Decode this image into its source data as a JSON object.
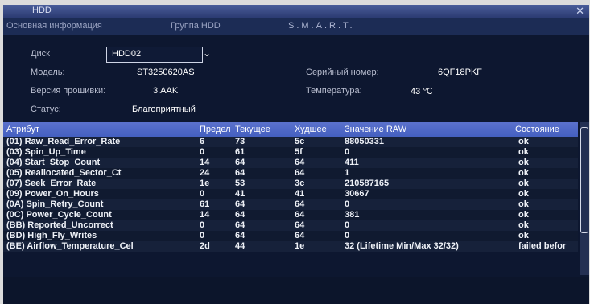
{
  "window": {
    "title": "HDD"
  },
  "tabs": [
    {
      "label": "Основная информация"
    },
    {
      "label": "Группа HDD"
    },
    {
      "label": "S.M.A.R.T."
    }
  ],
  "info": {
    "disk_label": "Диск",
    "disk_value": "HDD02",
    "model_label": "Модель:",
    "model_value": "ST3250620AS",
    "serial_label": "Серийный номер:",
    "serial_value": "6QF18PKF",
    "firmware_label": "Версия прошивки:",
    "firmware_value": "3.AAK",
    "temp_label": "Температура:",
    "temp_value": "43 ℃",
    "status_label": "Статус:",
    "status_value": "Благоприятный"
  },
  "table": {
    "headers": [
      "Атрибут",
      "Предел",
      "Текущее",
      "Худшее",
      "Значение RAW",
      "Состояние"
    ],
    "rows": [
      [
        "(01) Raw_Read_Error_Rate",
        "6",
        "73",
        "5c",
        "88050331",
        "ok"
      ],
      [
        "(03) Spin_Up_Time",
        "0",
        "61",
        "5f",
        "0",
        "ok"
      ],
      [
        "(04) Start_Stop_Count",
        "14",
        "64",
        "64",
        "411",
        "ok"
      ],
      [
        "(05) Reallocated_Sector_Ct",
        "24",
        "64",
        "64",
        "1",
        "ok"
      ],
      [
        "(07) Seek_Error_Rate",
        "1e",
        "53",
        "3c",
        "210587165",
        "ok"
      ],
      [
        "(09) Power_On_Hours",
        "0",
        "41",
        "41",
        "30667",
        "ok"
      ],
      [
        "(0A) Spin_Retry_Count",
        "61",
        "64",
        "64",
        "0",
        "ok"
      ],
      [
        "(0C) Power_Cycle_Count",
        "14",
        "64",
        "64",
        "381",
        "ok"
      ],
      [
        "(BB) Reported_Uncorrect",
        "0",
        "64",
        "64",
        "0",
        "ok"
      ],
      [
        "(BD) High_Fly_Writes",
        "0",
        "64",
        "64",
        "0",
        "ok"
      ],
      [
        "(BE) Airflow_Temperature_Cel",
        "2d",
        "44",
        "1e",
        "32 (Lifetime Min/Max 32/32)",
        "failed befor"
      ]
    ]
  }
}
